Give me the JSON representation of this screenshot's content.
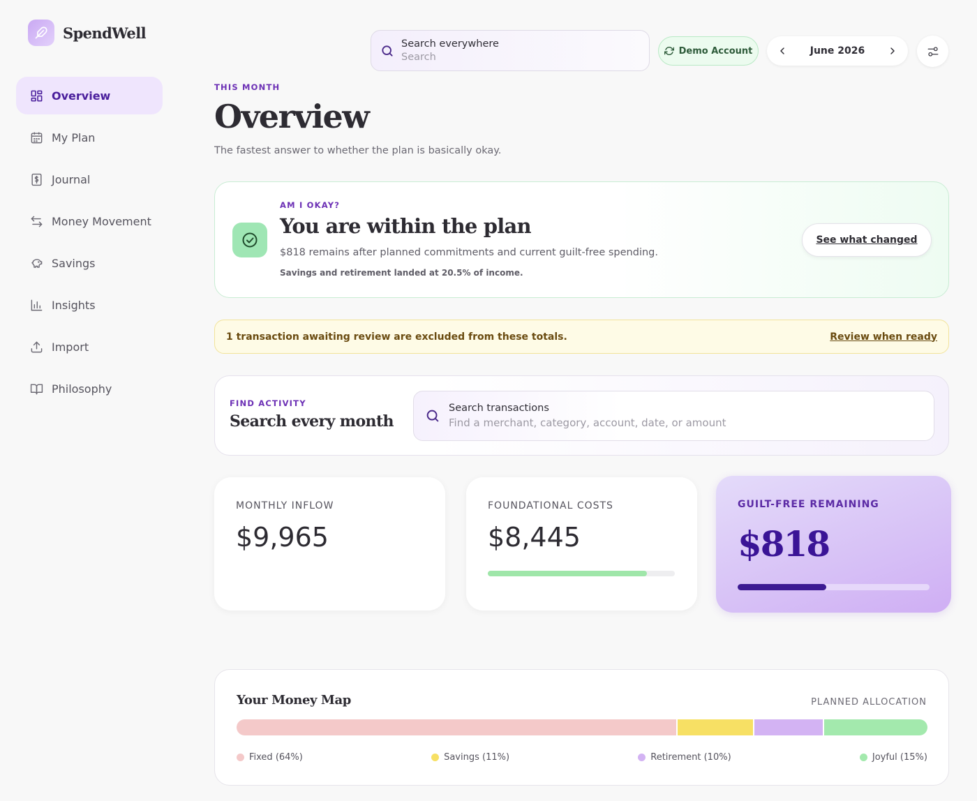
{
  "brand": {
    "name": "SpendWell",
    "icon": "feather-icon"
  },
  "sidebar": {
    "items": [
      {
        "label": "Overview",
        "icon": "dashboard-icon",
        "active": true
      },
      {
        "label": "My Plan",
        "icon": "calendar-icon"
      },
      {
        "label": "Journal",
        "icon": "dollar-receipt-icon"
      },
      {
        "label": "Money Movement",
        "icon": "transfer-arrows-icon"
      },
      {
        "label": "Savings",
        "icon": "piggy-bank-icon"
      },
      {
        "label": "Insights",
        "icon": "bar-chart-icon"
      },
      {
        "label": "Import",
        "icon": "upload-icon"
      },
      {
        "label": "Philosophy",
        "icon": "book-icon"
      }
    ]
  },
  "topbar": {
    "search_label": "Search everywhere",
    "search_placeholder": "Search",
    "demo_label": "Demo Account",
    "month": "June 2026"
  },
  "header": {
    "eyebrow": "THIS MONTH",
    "title": "Overview",
    "subtitle": "The fastest answer to whether the plan is basically okay."
  },
  "status": {
    "eyebrow": "AM I OKAY?",
    "title": "You are within the plan",
    "description": "$818 remains after planned commitments and current guilt-free spending.",
    "note": "Savings and retirement landed at 20.5% of income.",
    "button": "See what changed"
  },
  "warning": {
    "text": "1 transaction awaiting review are excluded from these totals.",
    "link": "Review when ready"
  },
  "find": {
    "eyebrow": "FIND ACTIVITY",
    "title": "Search every month",
    "label": "Search transactions",
    "placeholder": "Find a merchant, category, account, date, or amount"
  },
  "stats": {
    "inflow": {
      "label": "MONTHLY INFLOW",
      "value": "$9,965"
    },
    "foundational": {
      "label": "FOUNDATIONAL COSTS",
      "value": "$8,445",
      "progress": 0.85
    },
    "guilt_free": {
      "label": "GUILT-FREE REMAINING",
      "value": "$818",
      "progress": 0.46
    }
  },
  "money_map": {
    "title": "Your Money Map",
    "tag": "PLANNED ALLOCATION",
    "segments": [
      {
        "label": "Fixed (64%)",
        "share": 64,
        "color": "#f4c9c9"
      },
      {
        "label": "Savings (11%)",
        "share": 11,
        "color": "#f7e064"
      },
      {
        "label": "Retirement (10%)",
        "share": 10,
        "color": "#d3b3f3"
      },
      {
        "label": "Joyful (15%)",
        "share": 15,
        "color": "#a3e9ad"
      }
    ]
  },
  "colors": {
    "accent": "#6c30b5",
    "active_bg": "#efe5fd",
    "success": "#9fe6b4"
  }
}
